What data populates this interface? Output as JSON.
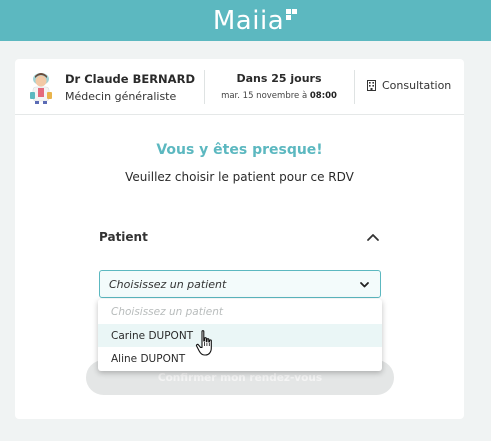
{
  "app": {
    "logo_text": "Maiia"
  },
  "doctor": {
    "name": "Dr Claude BERNARD",
    "specialty": "Médecin généraliste"
  },
  "appointment": {
    "relative": "Dans 25 jours",
    "date_prefix": "mar. 15 novembre à",
    "time": "08:00",
    "type": "Consultation"
  },
  "main": {
    "title": "Vous y êtes presque!",
    "subtitle": "Veuillez choisir le patient pour ce RDV"
  },
  "patient_section": {
    "label": "Patient",
    "select_value": "Choisissez un patient",
    "options": [
      {
        "label": "Choisissez un patient",
        "disabled": true
      },
      {
        "label": "Carine DUPONT",
        "hovered": true
      },
      {
        "label": "Aline DUPONT"
      }
    ]
  },
  "confirm_button": {
    "label": "Confirmer mon rendez-vous"
  },
  "colors": {
    "accent": "#5cb8c0",
    "background": "#f0f3f3"
  }
}
